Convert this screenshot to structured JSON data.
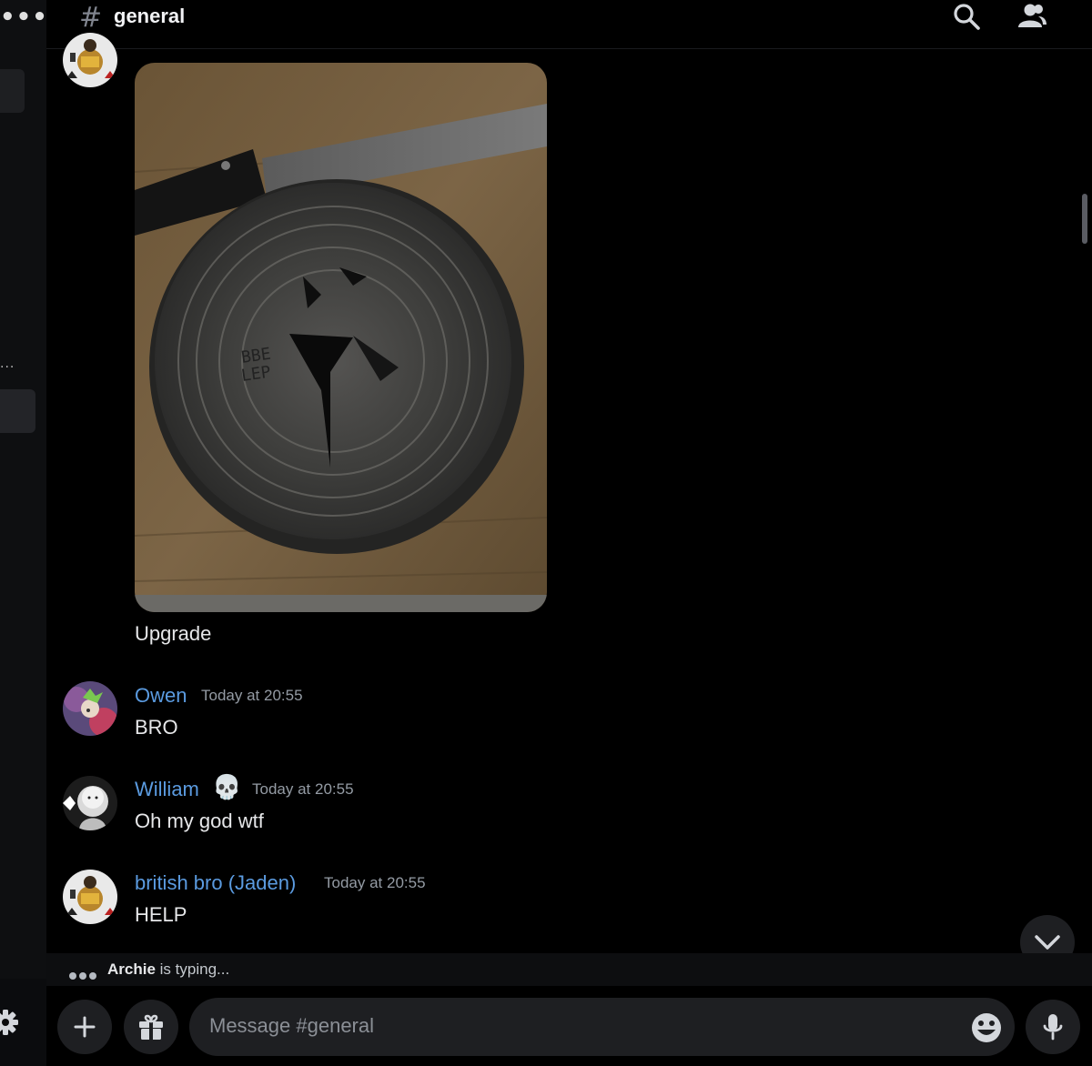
{
  "channel": {
    "name": "general"
  },
  "messages": [
    {
      "text": "Upgrade"
    },
    {
      "username": "Owen",
      "timestamp": "Today at 20:55",
      "text": "BRO"
    },
    {
      "username": "William",
      "badge": "💀",
      "timestamp": "Today at 20:55",
      "text": "Oh my god wtf"
    },
    {
      "username": "british bro (Jaden)",
      "timestamp": "Today at 20:55",
      "text": "HELP"
    }
  ],
  "typing": {
    "user": "Archie",
    "suffix": "is typing..."
  },
  "composer": {
    "placeholder": "Message #general"
  },
  "icons": {
    "header": [
      "search-icon",
      "members-icon"
    ],
    "composer": [
      "plus-icon",
      "gift-icon",
      "emoji-icon",
      "microphone-icon"
    ],
    "other": [
      "gear-icon",
      "chevron-down-icon"
    ]
  },
  "colors": {
    "username": "#5b9be0",
    "background": "#000000",
    "input": "#1e1f22"
  }
}
